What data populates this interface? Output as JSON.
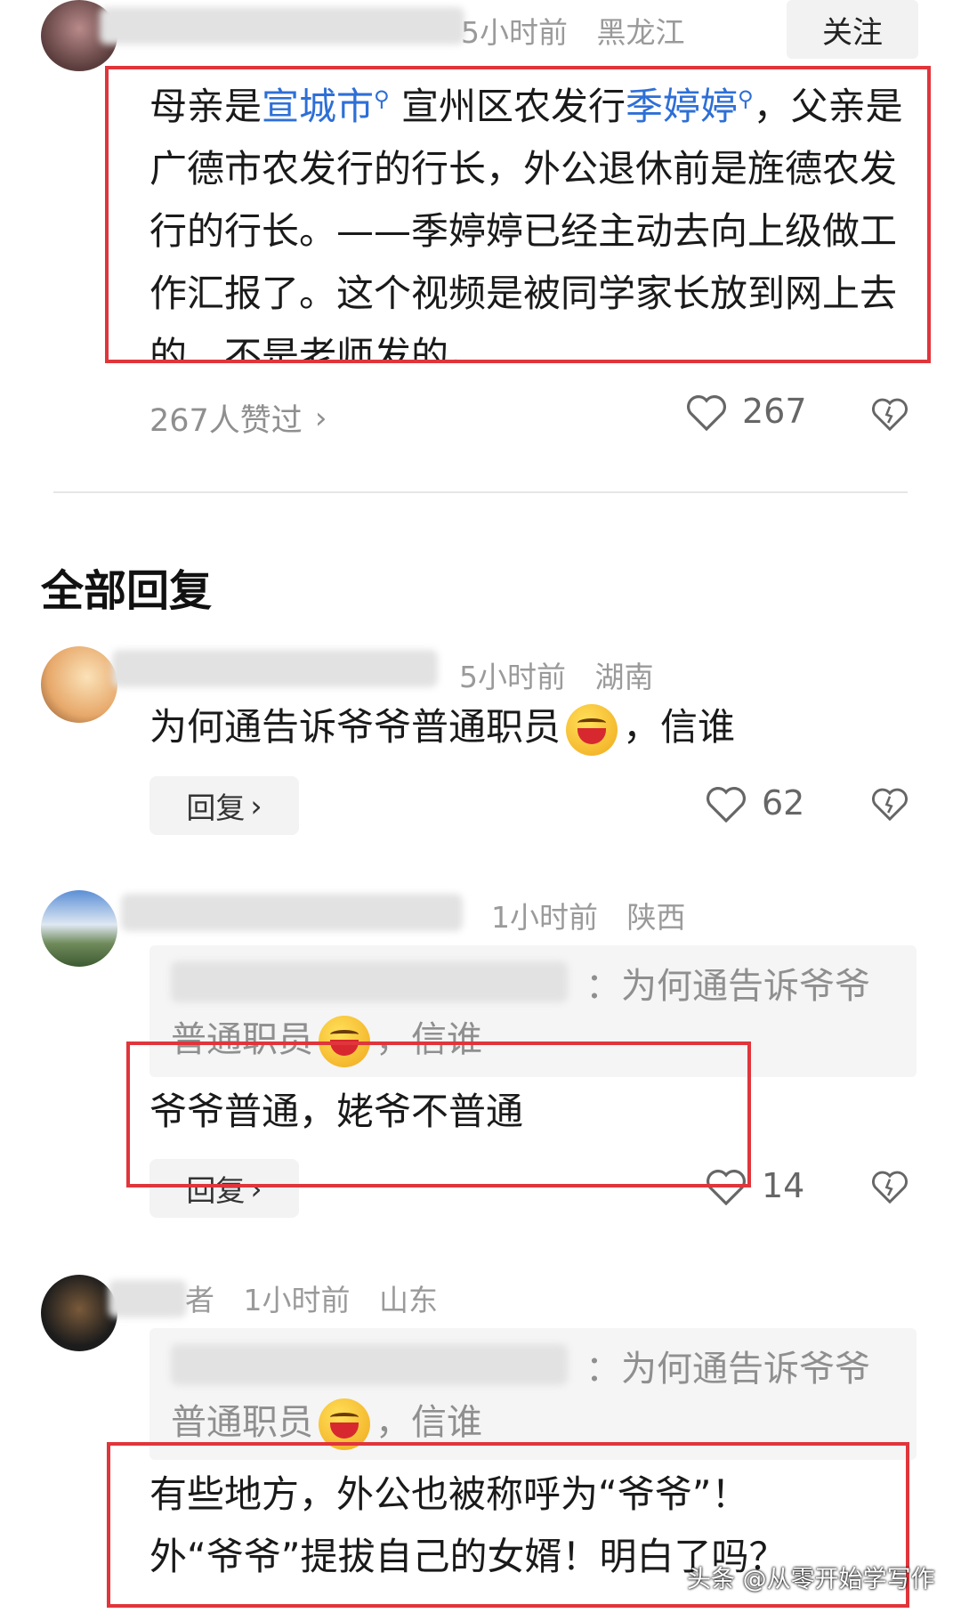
{
  "comment1": {
    "time": "5小时前",
    "location": "黑龙江",
    "follow_label": "关注",
    "text_parts": {
      "a": "母亲是",
      "link1": "宣城市",
      "b": " 宣州区农发行",
      "link2": "季婷婷",
      "c": "，父亲是广德市农发行的行长，外公退休前是旌德农发行的行长。——季婷婷已经主动去向上级做工作汇报了。这个视频是被同学家长放到网上去的，不是老师发的。"
    },
    "likes_summary": "267人赞过",
    "like_count": "267"
  },
  "section_title": "全部回复",
  "reply1": {
    "time": "5小时前",
    "location": "湖南",
    "text_a": "为何通告诉爷爷普通职员",
    "text_b": "，信谁",
    "reply_label": "回复",
    "like_count": "62"
  },
  "reply2": {
    "time": "1小时前",
    "location": "陕西",
    "quote_a": "：为何通告诉爷爷",
    "quote_b": "普通职员",
    "quote_c": "，信谁",
    "text": "爷爷普通，姥爷不普通",
    "reply_label": "回复",
    "like_count": "14"
  },
  "reply3": {
    "name_tail": "者",
    "time": "1小时前",
    "location": "山东",
    "quote_a": "：为何通告诉爷爷",
    "quote_b": "普通职员",
    "quote_c": "，信谁",
    "text_line1": "有些地方，外公也被称呼为“爷爷”！",
    "text_line2": "外“爷爷”提拔自己的女婿！明白了吗？"
  },
  "watermark": "头条 @从零开始学写作",
  "colors": {
    "accent_link": "#2e6fd6",
    "highlight_box": "#e0353b"
  }
}
